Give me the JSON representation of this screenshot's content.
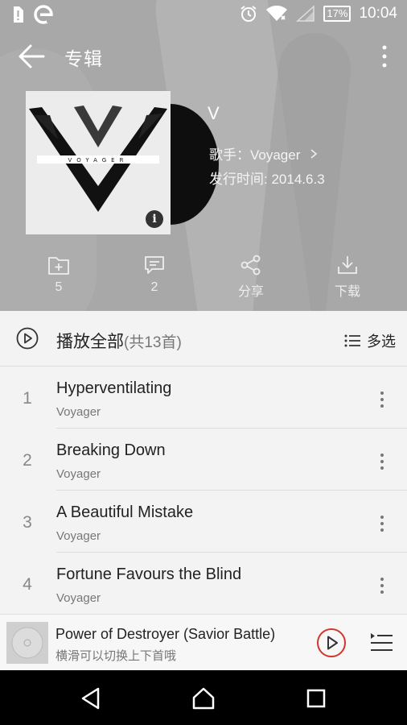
{
  "status": {
    "battery": "17%",
    "time": "10:04"
  },
  "header": {
    "title": "专辑"
  },
  "album": {
    "name": "V",
    "cover_text": "VOYAGER",
    "artist_label": "歌手：",
    "artist": "Voyager",
    "release_label": "发行时间:",
    "release_date": "2014.6.3"
  },
  "actions": [
    {
      "icon": "add-folder-icon",
      "label": "5"
    },
    {
      "icon": "comment-icon",
      "label": "2"
    },
    {
      "icon": "share-icon",
      "label": "分享"
    },
    {
      "icon": "download-icon",
      "label": "下载"
    }
  ],
  "play_all": {
    "label": "播放全部",
    "count": "(共13首)",
    "multi_select": "多选"
  },
  "songs": [
    {
      "index": "1",
      "title": "Hyperventilating",
      "artist": "Voyager"
    },
    {
      "index": "2",
      "title": "Breaking Down",
      "artist": "Voyager"
    },
    {
      "index": "3",
      "title": "A Beautiful Mistake",
      "artist": "Voyager"
    },
    {
      "index": "4",
      "title": "Fortune Favours the Blind",
      "artist": "Voyager"
    }
  ],
  "mini_player": {
    "title": "Power of Destroyer (Savior Battle)",
    "hint": "横滑可以切换上下首哦"
  },
  "colors": {
    "accent_red": "#d0362e",
    "hero_gray": "#a8a8a8"
  }
}
